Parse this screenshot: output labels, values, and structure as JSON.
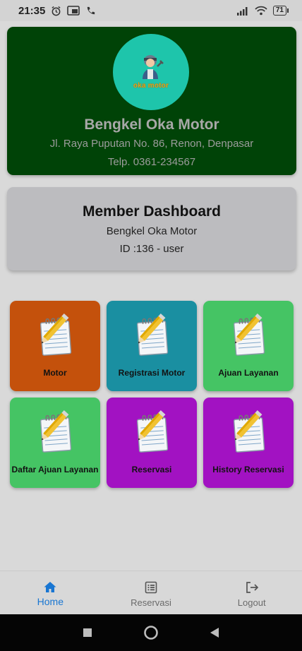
{
  "status_bar": {
    "time": "21:35",
    "battery": "71"
  },
  "header": {
    "logo_text": "oka motor",
    "shop_name": "Bengkel Oka Motor",
    "address": "Jl. Raya Puputan No. 86, Renon, Denpasar",
    "phone": "Telp. 0361-234567"
  },
  "dashboard": {
    "title": "Member Dashboard",
    "shop": "Bengkel Oka Motor",
    "id_line": "ID :136 - user"
  },
  "menu": {
    "items": [
      {
        "label": "Motor",
        "color": "#c4510c"
      },
      {
        "label": "Registrasi Motor",
        "color": "#1a8fa1"
      },
      {
        "label": "Ajuan Layanan",
        "color": "#45c464"
      },
      {
        "label": "Daftar Ajuan Layanan",
        "color": "#45c464"
      },
      {
        "label": "Reservasi",
        "color": "#a212c2"
      },
      {
        "label": "History Reservasi",
        "color": "#a212c2"
      }
    ]
  },
  "bottom_nav": {
    "home": "Home",
    "reservasi": "Reservasi",
    "logout": "Logout"
  },
  "colors": {
    "header_bg": "#004307",
    "logo_bg": "#1ec5ab",
    "active_nav": "#1976d2"
  }
}
